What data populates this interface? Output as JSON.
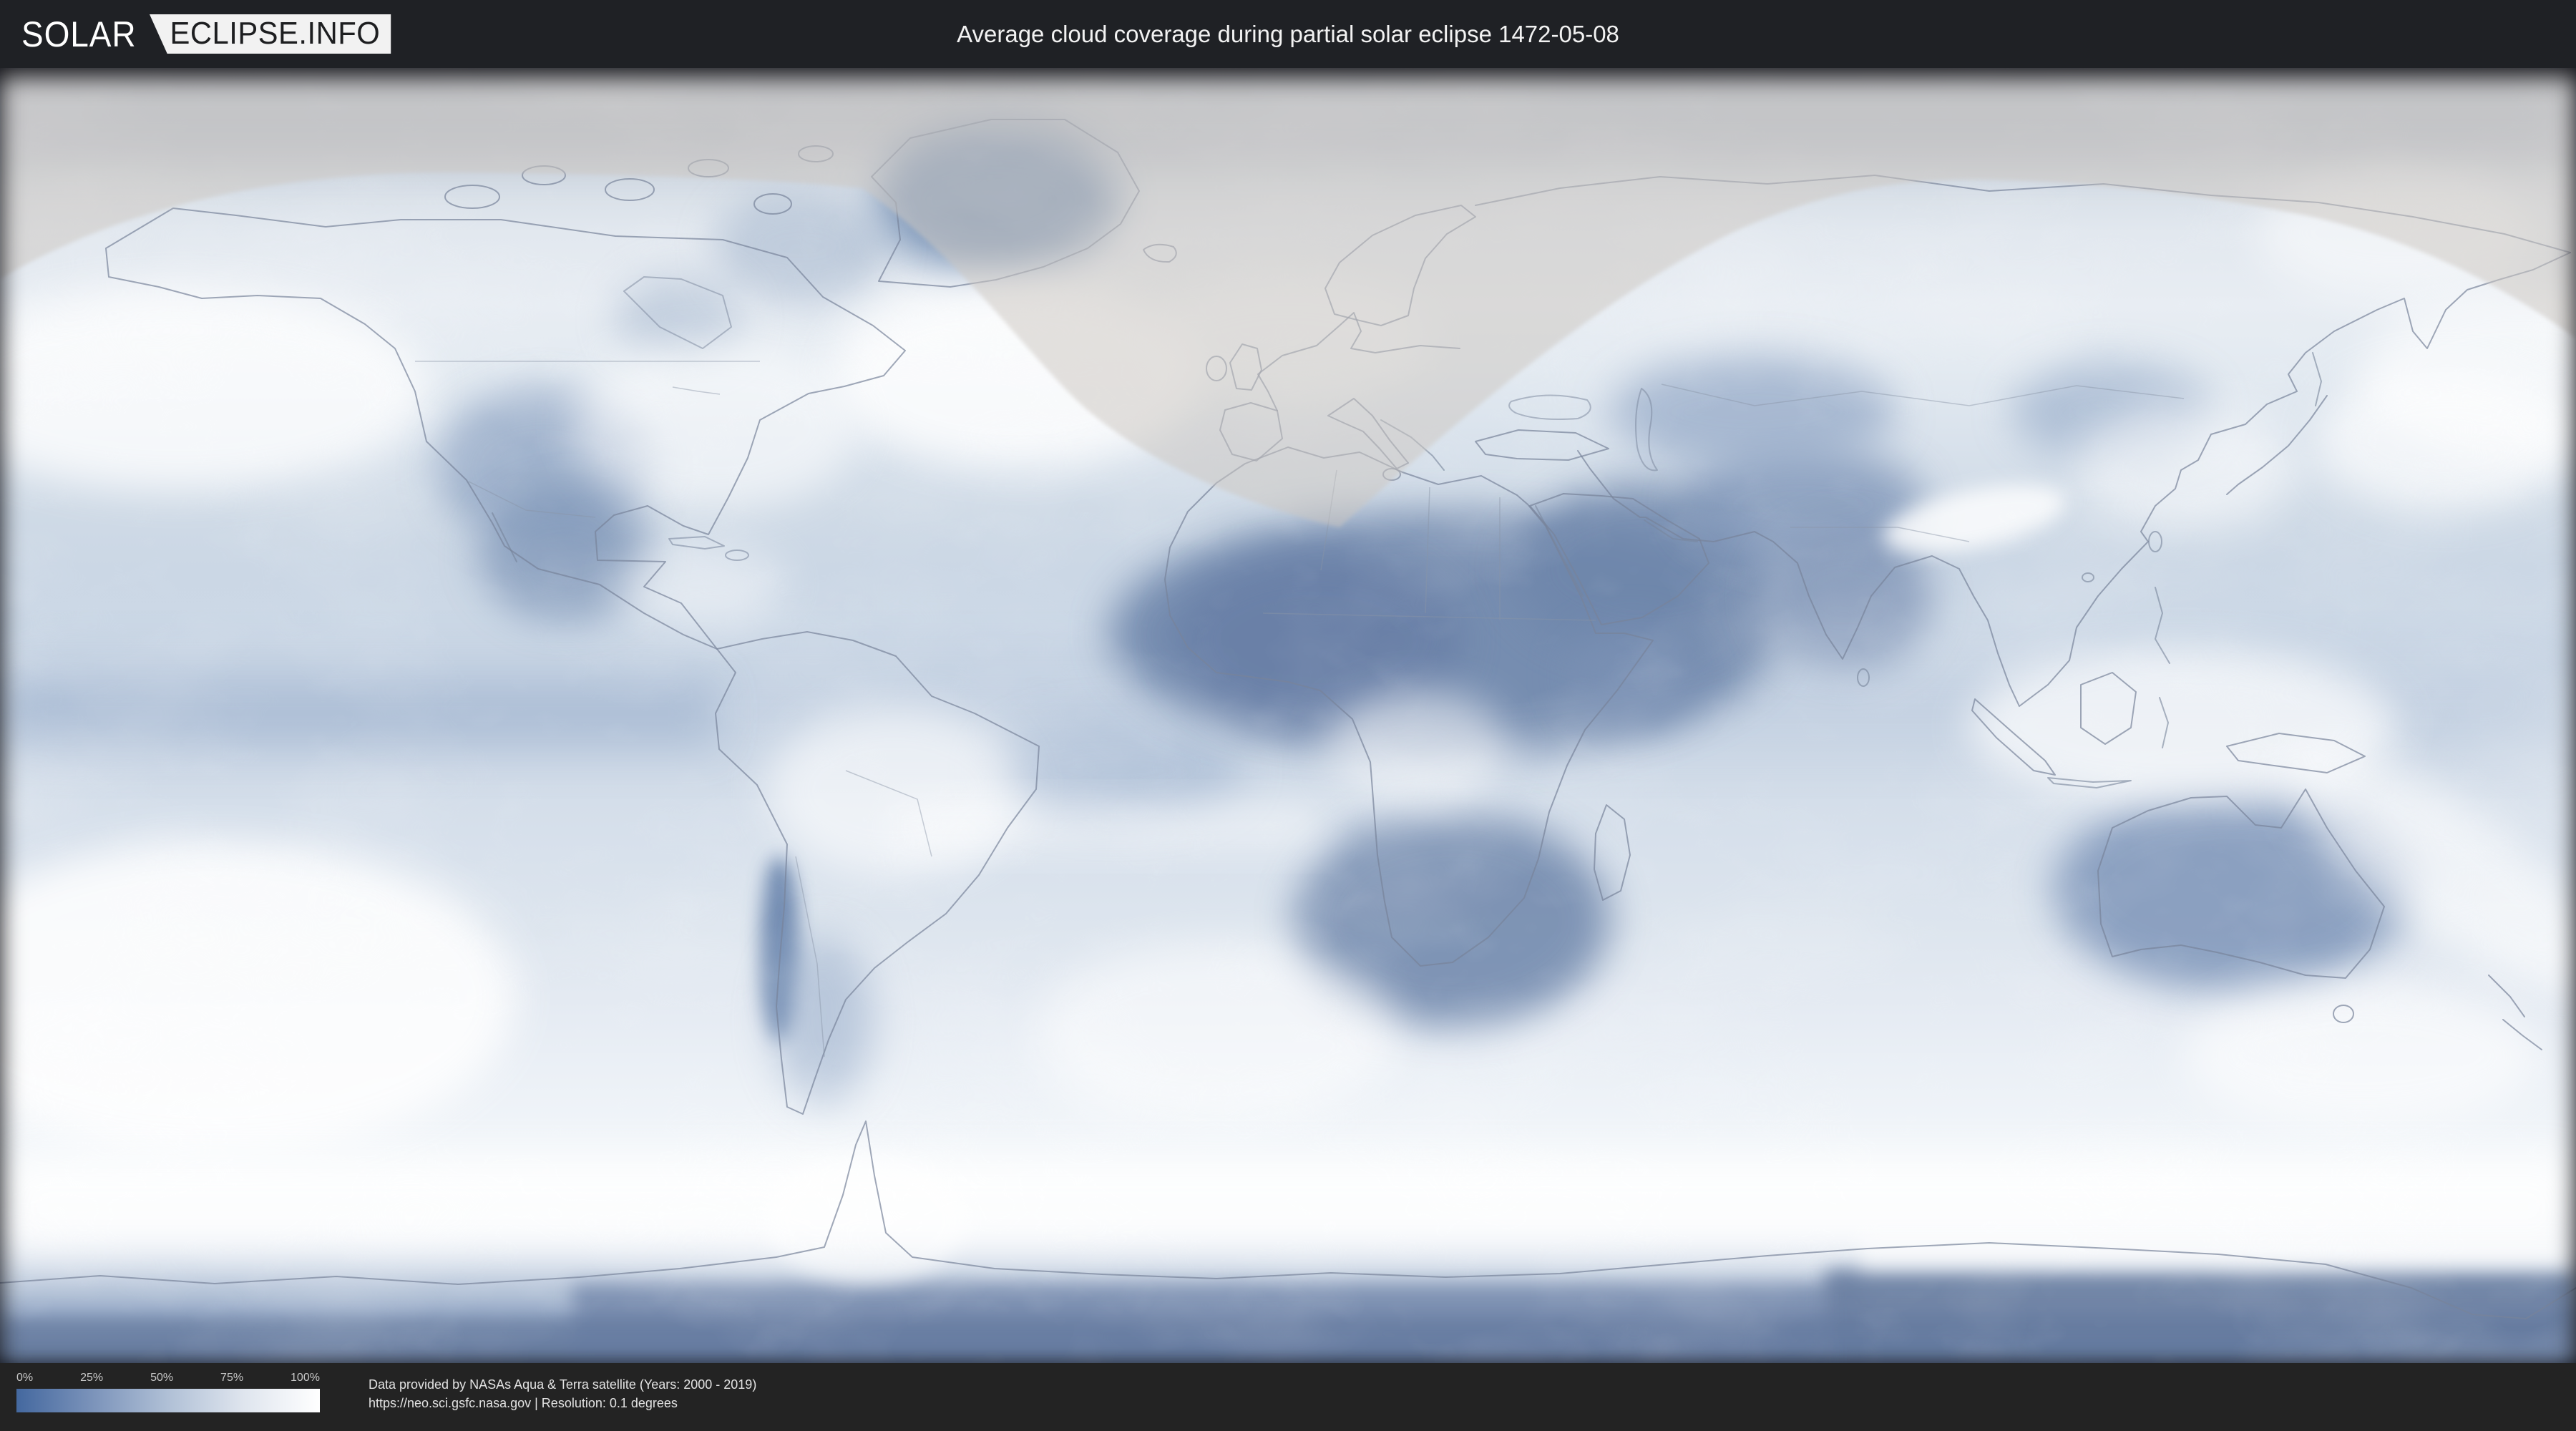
{
  "header": {
    "logo": {
      "primary": "SOLAR",
      "secondary": "ECLIPSE.INFO"
    },
    "title": "Average cloud coverage during partial solar eclipse 1472-05-08"
  },
  "map": {
    "subject": "world-cloud-coverage-map",
    "eclipse_overlay_color": "#cec8c1"
  },
  "legend": {
    "ticks": [
      "0%",
      "25%",
      "50%",
      "75%",
      "100%"
    ],
    "gradient_stops": [
      "#44689f",
      "#7b93ba",
      "#b0c0d6",
      "#dfe5ee",
      "#ffffff"
    ]
  },
  "footer": {
    "attribution_line1": "Data provided by NASAs Aqua & Terra satellite (Years: 2000 - 2019)",
    "attribution_line2": "https://neo.sci.gsfc.nasa.gov | Resolution: 0.1 degrees"
  },
  "colors": {
    "header_bg": "#1f2125",
    "footer_bg": "#232323",
    "logo_box_bg": "#f2f2f2",
    "logo_text_dark": "#1d1e20",
    "title_text": "#f2f2f2",
    "eclipse_overlay": "#cec8c1"
  }
}
